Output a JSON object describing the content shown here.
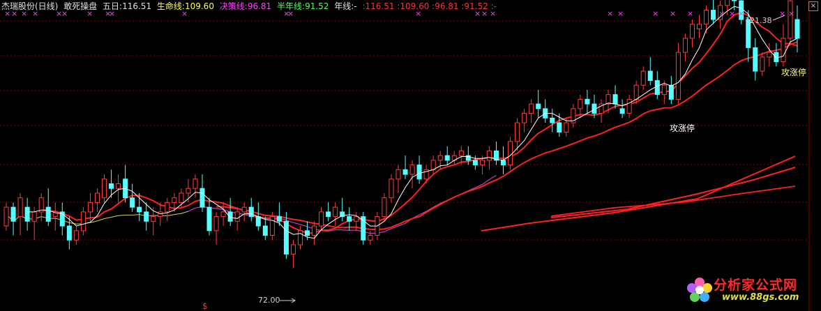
{
  "header": {
    "stock": "杰瑞股份(日线)",
    "indicator": "敢死操盘",
    "ma5": "五日:116.51",
    "life_line": "生命线:109.60",
    "decision_line": "决策线:96.81",
    "half_year_line": "半年线:91.52",
    "year_line": "年线:-",
    "extra": ":116.51 :109.60 :96.81 :91.52 :-"
  },
  "watermark": {
    "title": "分析家公式网",
    "url": "www.88gs.com"
  },
  "colors": {
    "up": "#ff3c3c",
    "down": "#54ffff",
    "ma5": "#ffffff",
    "life": "#ff2020",
    "decision_purple": "#c040c0",
    "decision_yellow": "#d8d060",
    "grid": "#8b0000",
    "marker": "#ff40ff"
  },
  "chart_data": {
    "type": "candlestick",
    "y_range": [
      66,
      125
    ],
    "grid": true,
    "annotations": {
      "high_label": "121.38",
      "low_label": "72.00",
      "limit_up_label_1": "攻涨停",
      "limit_up_label_2": "攻涨停",
      "dollar_marker": "$",
      "cross_marker": "×"
    },
    "candles": [
      [
        81,
        86,
        80,
        85
      ],
      [
        85,
        86,
        79,
        82
      ],
      [
        83,
        88,
        79,
        87
      ],
      [
        85,
        87,
        80,
        82
      ],
      [
        82,
        85,
        78,
        84
      ],
      [
        84,
        88,
        82,
        87
      ],
      [
        85,
        89,
        81,
        82
      ],
      [
        83,
        86,
        80,
        84
      ],
      [
        84,
        86,
        79,
        81
      ],
      [
        81,
        83,
        76,
        78
      ],
      [
        78,
        81,
        77,
        80
      ],
      [
        80,
        85,
        79,
        84
      ],
      [
        84,
        88,
        82,
        86
      ],
      [
        86,
        89,
        84,
        88
      ],
      [
        87,
        92,
        86,
        91
      ],
      [
        90,
        93,
        87,
        89
      ],
      [
        89,
        92,
        86,
        90
      ],
      [
        91,
        94,
        86,
        87
      ],
      [
        87,
        90,
        84,
        85
      ],
      [
        85,
        88,
        82,
        84
      ],
      [
        84,
        86,
        80,
        82
      ],
      [
        82,
        85,
        79,
        83
      ],
      [
        83,
        86,
        81,
        84
      ],
      [
        84,
        87,
        82,
        86
      ],
      [
        86,
        88,
        84,
        87
      ],
      [
        86,
        89,
        85,
        88
      ],
      [
        88,
        91,
        86,
        89
      ],
      [
        89,
        92,
        87,
        91
      ],
      [
        89,
        92,
        84,
        85
      ],
      [
        85,
        87,
        79,
        80
      ],
      [
        80,
        84,
        77,
        83
      ],
      [
        83,
        86,
        81,
        84
      ],
      [
        84,
        87,
        81,
        82
      ],
      [
        82,
        85,
        80,
        84
      ],
      [
        84,
        86,
        82,
        85
      ],
      [
        85,
        87,
        82,
        83
      ],
      [
        83,
        86,
        80,
        81
      ],
      [
        81,
        83,
        78,
        79
      ],
      [
        79,
        84,
        78,
        83
      ],
      [
        83,
        86,
        81,
        82
      ],
      [
        82,
        84,
        74,
        75
      ],
      [
        75,
        78,
        72,
        77
      ],
      [
        77,
        81,
        76,
        80
      ],
      [
        80,
        82,
        78,
        79
      ],
      [
        79,
        82,
        77,
        81
      ],
      [
        81,
        85,
        80,
        84
      ],
      [
        84,
        86,
        82,
        83
      ],
      [
        83,
        86,
        81,
        85
      ],
      [
        84,
        87,
        82,
        83
      ],
      [
        83,
        85,
        80,
        82
      ],
      [
        82,
        84,
        80,
        83
      ],
      [
        83,
        84,
        77,
        78
      ],
      [
        78,
        80,
        77,
        79
      ],
      [
        79,
        84,
        78,
        83
      ],
      [
        83,
        88,
        82,
        87
      ],
      [
        87,
        92,
        86,
        91
      ],
      [
        91,
        94,
        88,
        93
      ],
      [
        93,
        96,
        91,
        92
      ],
      [
        92,
        95,
        89,
        94
      ],
      [
        94,
        96,
        90,
        91
      ],
      [
        91,
        94,
        90,
        93
      ],
      [
        93,
        96,
        92,
        95
      ],
      [
        95,
        97,
        93,
        96
      ],
      [
        96,
        98,
        94,
        95
      ],
      [
        95,
        97,
        94,
        96
      ],
      [
        96,
        98,
        94,
        97
      ],
      [
        96,
        98,
        94,
        95
      ],
      [
        95,
        96,
        93,
        94
      ],
      [
        94,
        96,
        92,
        95
      ],
      [
        95,
        98,
        93,
        97
      ],
      [
        97,
        99,
        94,
        95
      ],
      [
        95,
        98,
        92,
        94
      ],
      [
        94,
        100,
        93,
        99
      ],
      [
        99,
        104,
        97,
        103
      ],
      [
        103,
        106,
        101,
        105
      ],
      [
        105,
        108,
        103,
        107
      ],
      [
        107,
        110,
        104,
        106
      ],
      [
        106,
        108,
        103,
        104
      ],
      [
        104,
        106,
        101,
        103
      ],
      [
        103,
        105,
        100,
        101
      ],
      [
        101,
        104,
        100,
        103
      ],
      [
        103,
        107,
        102,
        106
      ],
      [
        106,
        109,
        104,
        108
      ],
      [
        108,
        110,
        105,
        107
      ],
      [
        107,
        109,
        104,
        105
      ],
      [
        105,
        108,
        103,
        107
      ],
      [
        107,
        110,
        105,
        109
      ],
      [
        109,
        111,
        106,
        107
      ],
      [
        106,
        108,
        104,
        105
      ],
      [
        105,
        109,
        104,
        108
      ],
      [
        108,
        112,
        107,
        111
      ],
      [
        111,
        115,
        110,
        114
      ],
      [
        114,
        117,
        111,
        112
      ],
      [
        112,
        114,
        108,
        109
      ],
      [
        109,
        112,
        107,
        111
      ],
      [
        111,
        113,
        107,
        108
      ],
      [
        108,
        120,
        107,
        118
      ],
      [
        118,
        122,
        116,
        121
      ],
      [
        121,
        125,
        119,
        124
      ],
      [
        123,
        126,
        121,
        124
      ],
      [
        124,
        128,
        122,
        127
      ],
      [
        127,
        130,
        124,
        125
      ],
      [
        125,
        129,
        123,
        128
      ],
      [
        128,
        131,
        126,
        130
      ],
      [
        130,
        132,
        127,
        129
      ],
      [
        129,
        131,
        124,
        125
      ],
      [
        125,
        127,
        116,
        119
      ],
      [
        119,
        121,
        112,
        114
      ],
      [
        114,
        118,
        113,
        117
      ],
      [
        117,
        120,
        115,
        118
      ],
      [
        118,
        120,
        115,
        116
      ],
      [
        116,
        124,
        115,
        121
      ],
      [
        121,
        130,
        120,
        129
      ],
      [
        125,
        128,
        118,
        121
      ]
    ]
  }
}
